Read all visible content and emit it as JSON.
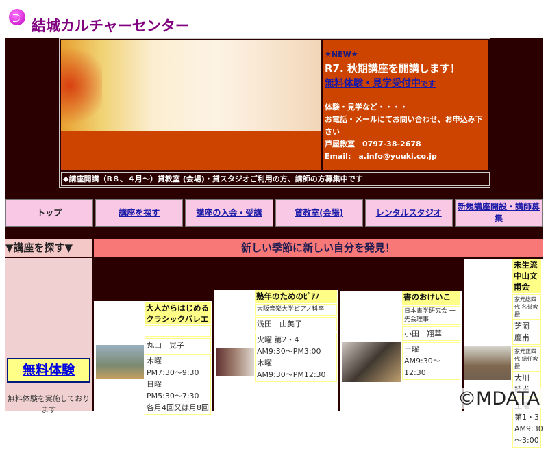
{
  "header": {
    "title": "結城カルチャーセンター"
  },
  "banner": {
    "new_label": "★NEW★",
    "headline": "R7. 秋期講座を開講します！",
    "link_main": "無料体験・見学受付中",
    "link_suffix": "です",
    "info1": "体験・見学など・・・・",
    "info2": "お電話・メールにてお問い合わせ、お申込み下さい",
    "phone": "芦屋教室　0797-38-2678",
    "email": "Email:　a.info@yuuki.co.jp",
    "notice": "◆講座開講（R８、４月～）貸教室 (会場)・貸スタジオご利用の方、講師の方募集中です"
  },
  "nav": [
    "トップ",
    "講座を探す",
    "講座の入会・受講",
    "貸教室(会場)",
    "レンタルスタジオ",
    "新規講座開設・講師募集"
  ],
  "search_heading": "▼講座を探す▼",
  "slogan": "新しい季節に新しい自分を発見！",
  "left": {
    "free_trial": "無料体験",
    "note": "無料体験を実施しております"
  },
  "courses": [
    {
      "title": "大人からはじめるクラシックバレエ",
      "teacher": "丸山　晃子",
      "schedule": [
        "木曜",
        "PM7:30～9:30",
        "日曜",
        "PM5:30～7:30",
        "各月4回又は月8回"
      ]
    },
    {
      "title": "熟年のためのﾋﾟｱﾉ",
      "subtitle": "大阪音楽大学ピアノ科卒",
      "teacher": "浅田　由美子",
      "schedule": [
        "火曜 第2・4",
        "AM9:30～PM3:00",
        "木曜",
        "AM9:30～PM12:30"
      ]
    },
    {
      "title": "書のおけいこ",
      "subtitle": "日本書学研究会 一先会理事",
      "teacher": "小田　翔華",
      "schedule": [
        "土曜",
        "AM9:30～12:30"
      ]
    },
    {
      "title": "未生流中山文甫会",
      "sub1": "家元総四代 名誉教授",
      "teacher1": "芝岡 慶甫",
      "sub2": "家元正四代 総任教授",
      "teacher2": "大川 睦甫",
      "schedule": [
        "土曜",
        "第1・3",
        "AM9:30",
        "～3:00"
      ]
    }
  ],
  "watermark": "©MDATA"
}
